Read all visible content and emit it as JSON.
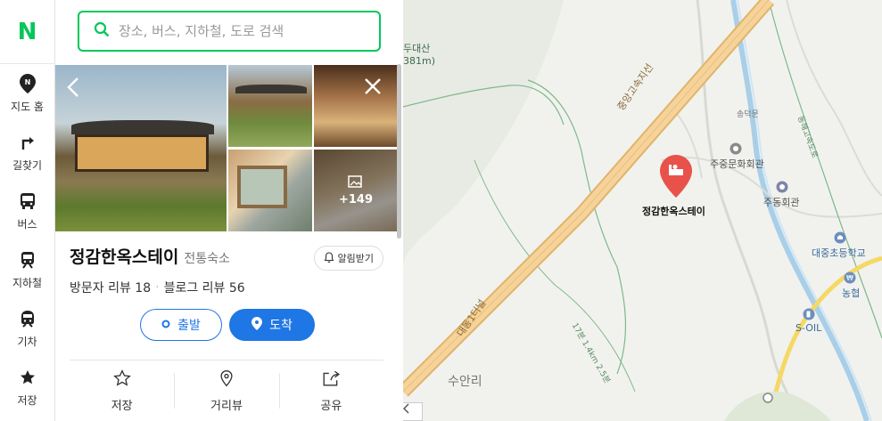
{
  "logo": "N",
  "rail": [
    {
      "key": "home",
      "label": "지도 홈",
      "icon": "map-pin-n-icon"
    },
    {
      "key": "directions",
      "label": "길찾기",
      "icon": "turn-arrow-icon"
    },
    {
      "key": "bus",
      "label": "버스",
      "icon": "bus-icon"
    },
    {
      "key": "subway",
      "label": "지하철",
      "icon": "subway-icon"
    },
    {
      "key": "train",
      "label": "기차",
      "icon": "train-icon"
    },
    {
      "key": "saved",
      "label": "저장",
      "icon": "star-icon"
    }
  ],
  "search": {
    "placeholder": "장소, 버스, 지하철, 도로 검색"
  },
  "gallery": {
    "more_count": "+149"
  },
  "place": {
    "name": "정감한옥스테이",
    "category": "전통숙소",
    "notify_label": "알림받기",
    "visitor_reviews": "방문자 리뷰 18",
    "blog_reviews": "블로그 리뷰 56"
  },
  "route": {
    "depart": "출발",
    "arrive": "도착"
  },
  "actions": {
    "save": "저장",
    "street_view": "거리뷰",
    "share": "공유"
  },
  "map": {
    "labels": {
      "mountain_top": "두대산",
      "mountain_elev": "381m)",
      "highway_upper": "중앙고속지선",
      "highway_lower": "대동1터널",
      "trail": "17분 1.4km 2.5분",
      "village": "수안리",
      "songdeok": "송덕문",
      "cultural_hall": "주중문화회관",
      "place_pin": "정감한옥스테이",
      "community_hall": "주동회관",
      "school": "대중초등학교",
      "nonghyup": "농협",
      "soil": "S-OIL",
      "riverside_road": "동해고속도로"
    }
  },
  "colors": {
    "brand": "#03c75a",
    "primary": "#1f77e5",
    "pin": "#e8524a",
    "highway": "#f0c27a"
  }
}
